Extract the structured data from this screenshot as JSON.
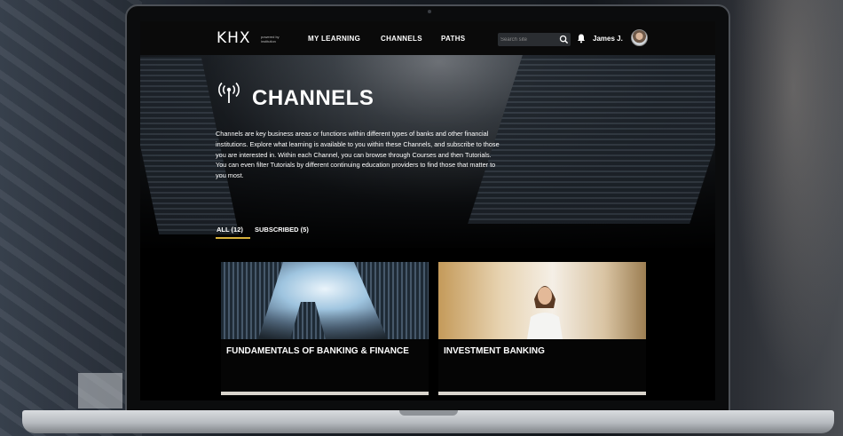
{
  "nav": {
    "logo": "KHX",
    "logo_tagline": "powered by institution",
    "links": [
      "MY LEARNING",
      "CHANNELS",
      "PATHS"
    ],
    "search_placeholder": "Search site",
    "user_name": "James J."
  },
  "hero": {
    "title": "CHANNELS",
    "intro": "Channels are key business areas or functions within different types of banks and other financial institutions. Explore what learning is available to you within these Channels, and subscribe to those you are interested in. Within each Channel, you can browse through Courses and then Tutorials. You can even filter Tutorials by different continuing education providers to find those that matter to you most."
  },
  "tabs": [
    "ALL (12)",
    "SUBSCRIBED (5)"
  ],
  "cards": [
    {
      "title": "FUNDAMENTALS OF BANKING & FINANCE"
    },
    {
      "title": "INVESTMENT BANKING"
    }
  ],
  "colors": {
    "accent": "#d7b13c",
    "nav_bg": "#0a0a0a",
    "text": "#ffffff"
  },
  "icons": [
    "search-icon",
    "bell-icon",
    "broadcast-icon"
  ]
}
